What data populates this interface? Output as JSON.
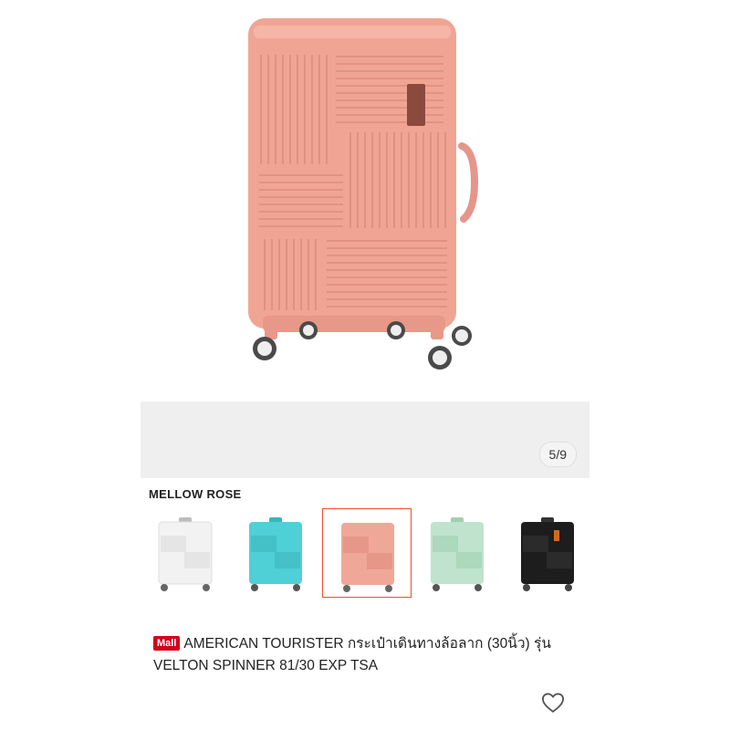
{
  "gallery": {
    "page_counter": "5/9"
  },
  "variant": {
    "selected_name": "MELLOW ROSE",
    "swatches": [
      {
        "color": "#f2f2f2",
        "selected": false
      },
      {
        "color": "#4fd0d6",
        "selected": false
      },
      {
        "color": "#efa898",
        "selected": true
      },
      {
        "color": "#bfe3cc",
        "selected": false
      },
      {
        "color": "#1d1d1d",
        "selected": false
      }
    ]
  },
  "product": {
    "mall_badge": "Mall",
    "title": "AMERICAN TOURISTER กระเป๋าเดินทางล้อลาก (30นิ้ว) รุ่น VELTON SPINNER 81/30 EXP TSA"
  },
  "colors": {
    "suitcase_main": "#f0a594",
    "accent": "#ee4d2d",
    "mall_badge": "#d0011b"
  },
  "icons": {
    "favorite": "heart-icon"
  }
}
